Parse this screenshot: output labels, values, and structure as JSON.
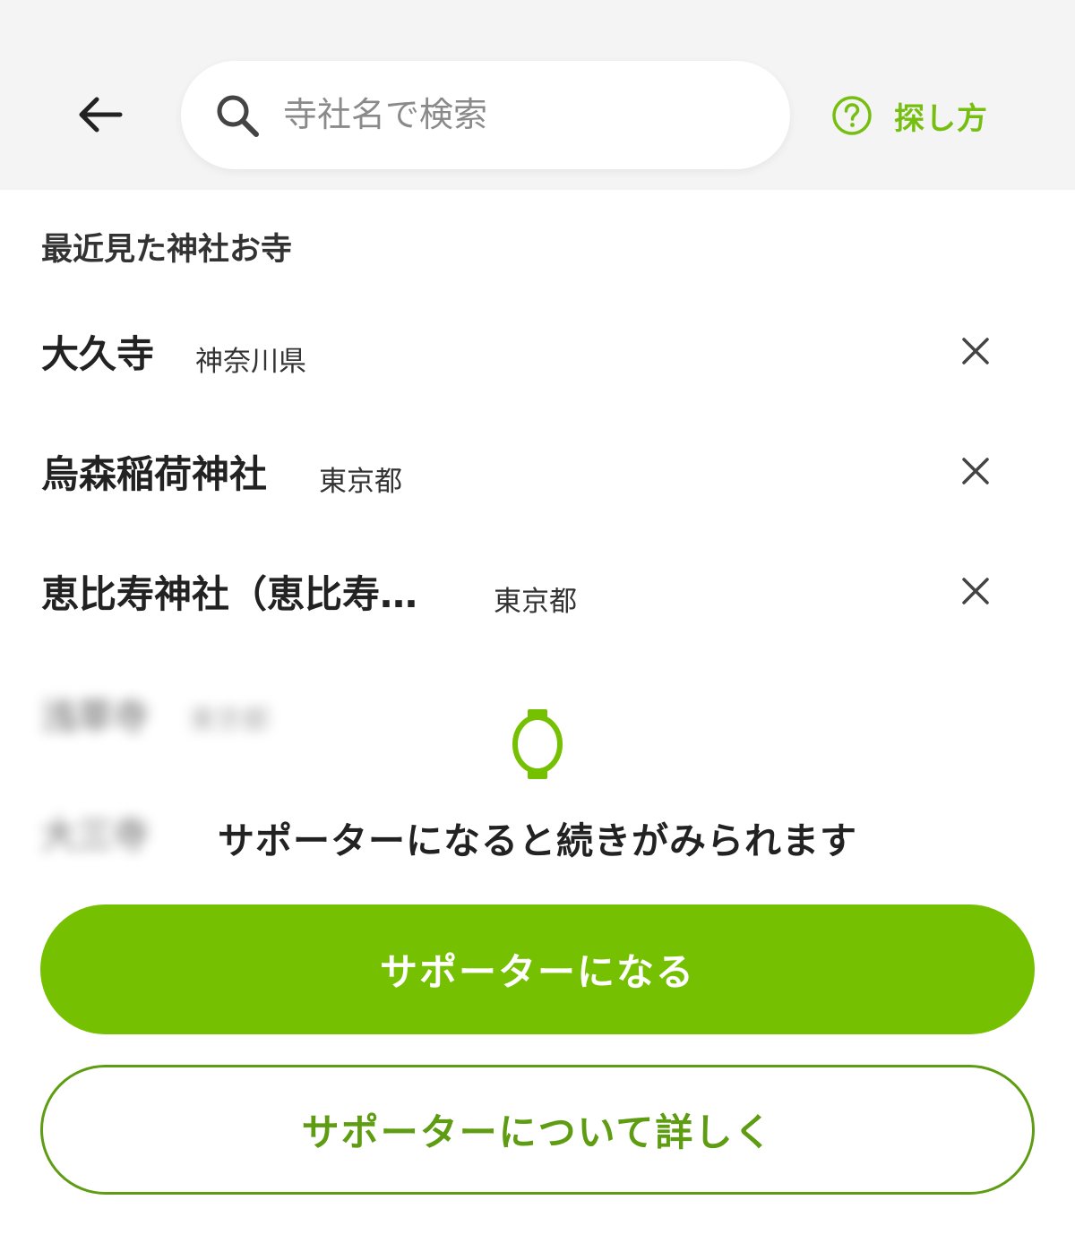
{
  "header": {
    "back_icon": "arrow-left-icon",
    "search": {
      "placeholder": "寺社名で検索",
      "value": "",
      "icon": "search-icon"
    },
    "help": {
      "icon": "question-circle-icon",
      "label": "探し方"
    }
  },
  "recent": {
    "title": "最近見た神社お寺",
    "items": [
      {
        "name": "大久寺",
        "prefecture": "神奈川県"
      },
      {
        "name": "烏森稲荷神社",
        "prefecture": "東京都"
      },
      {
        "name": "恵比寿神社（恵比寿…",
        "prefecture": "東京都"
      }
    ],
    "remove_icon": "close-icon",
    "locked_items": [
      {
        "name": "浅草寺",
        "prefecture": "東京都"
      },
      {
        "name": "大三寺",
        "prefecture": ""
      }
    ]
  },
  "paywall": {
    "lock_icon": "lock-icon",
    "message": "サポーターになると続きがみられます",
    "primary_button": "サポーターになる",
    "secondary_button": "サポーターについて詳しく"
  },
  "colors": {
    "accent": "#75c000",
    "accent_dark": "#5e9c12",
    "header_bg": "#f4f4f4",
    "text": "#222222"
  }
}
